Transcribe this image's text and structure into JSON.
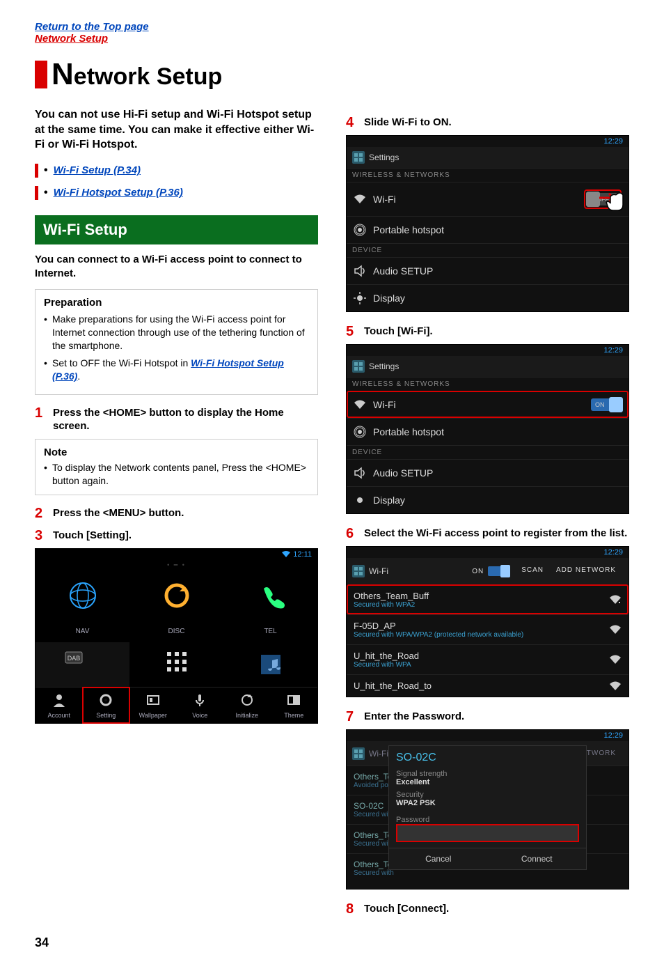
{
  "nav": {
    "top": "Return to the Top page",
    "sub": "Network Setup"
  },
  "title": "etwork Setup",
  "title_cap": "N",
  "intro": "You can not use Hi-Fi setup and Wi-Fi Hotspot setup at the same time. You can make it effective either Wi-Fi or Wi-Fi Hotspot.",
  "links": [
    "Wi-Fi Setup (P.34)",
    "Wi-Fi Hotspot Setup (P.36)"
  ],
  "section": "Wi-Fi Setup",
  "lead": "You can connect to a Wi-Fi access point to connect to Internet.",
  "prep": {
    "title": "Preparation",
    "items": [
      "Make preparations for using the Wi-Fi access point for Internet connection through use of the tethering function of the smartphone.",
      "Set to OFF the Wi-Fi Hotspot in "
    ],
    "link": "Wi-Fi Hotspot Setup (P.36)"
  },
  "steps": {
    "s1": "Press the <HOME> button to display the Home screen.",
    "s2": "Press the <MENU> button.",
    "s3": "Touch [Setting].",
    "s4": "Slide Wi-Fi to ON.",
    "s5": "Touch [Wi-Fi].",
    "s6": "Select the Wi-Fi access point to register from the list.",
    "s7": "Enter the Password.",
    "s8": "Touch [Connect]."
  },
  "note": {
    "title": "Note",
    "text": "To display the Network contents panel, Press the <HOME> button again."
  },
  "shot_common": {
    "clock1": "12:11",
    "clock2": "12:29",
    "settings": "Settings",
    "hdr_wireless": "WIRELESS & NETWORKS",
    "hdr_device": "DEVICE",
    "wifi": "Wi-Fi",
    "hotspot": "Portable hotspot",
    "audio": "Audio SETUP",
    "display": "Display",
    "off": "OFF",
    "on": "ON",
    "scan": "SCAN",
    "addnet": "ADD NETWORK"
  },
  "homegrid": {
    "row2": [
      "NAV",
      "DISC",
      "TEL"
    ],
    "dab": "DAB",
    "bottom": [
      "Account",
      "Setting",
      "Wallpaper",
      "Voice",
      "Initialize",
      "Theme"
    ]
  },
  "wlist": [
    {
      "name": "Others_Team_Buff",
      "sec": "Secured with WPA2"
    },
    {
      "name": "F-05D_AP",
      "sec": "Secured with WPA/WPA2 (protected network available)"
    },
    {
      "name": "U_hit_the_Road",
      "sec": "Secured with WPA"
    },
    {
      "name": "U_hit_the_Road_to",
      "sec": ""
    }
  ],
  "dialog": {
    "ssid": "SO-02C",
    "sig_k": "Signal strength",
    "sig_v": "Excellent",
    "sec_k": "Security",
    "sec_v": "WPA2 PSK",
    "pw_k": "Password",
    "cancel": "Cancel",
    "connect": "Connect",
    "ghost": [
      {
        "n": "Others_Tea",
        "s": "Avoided poor"
      },
      {
        "n": "SO-02C",
        "s": "Secured with"
      },
      {
        "n": "Others_Tea",
        "s": "Secured with"
      },
      {
        "n": "Others_Tea",
        "s": "Secured with"
      }
    ]
  },
  "pagenum": "34"
}
